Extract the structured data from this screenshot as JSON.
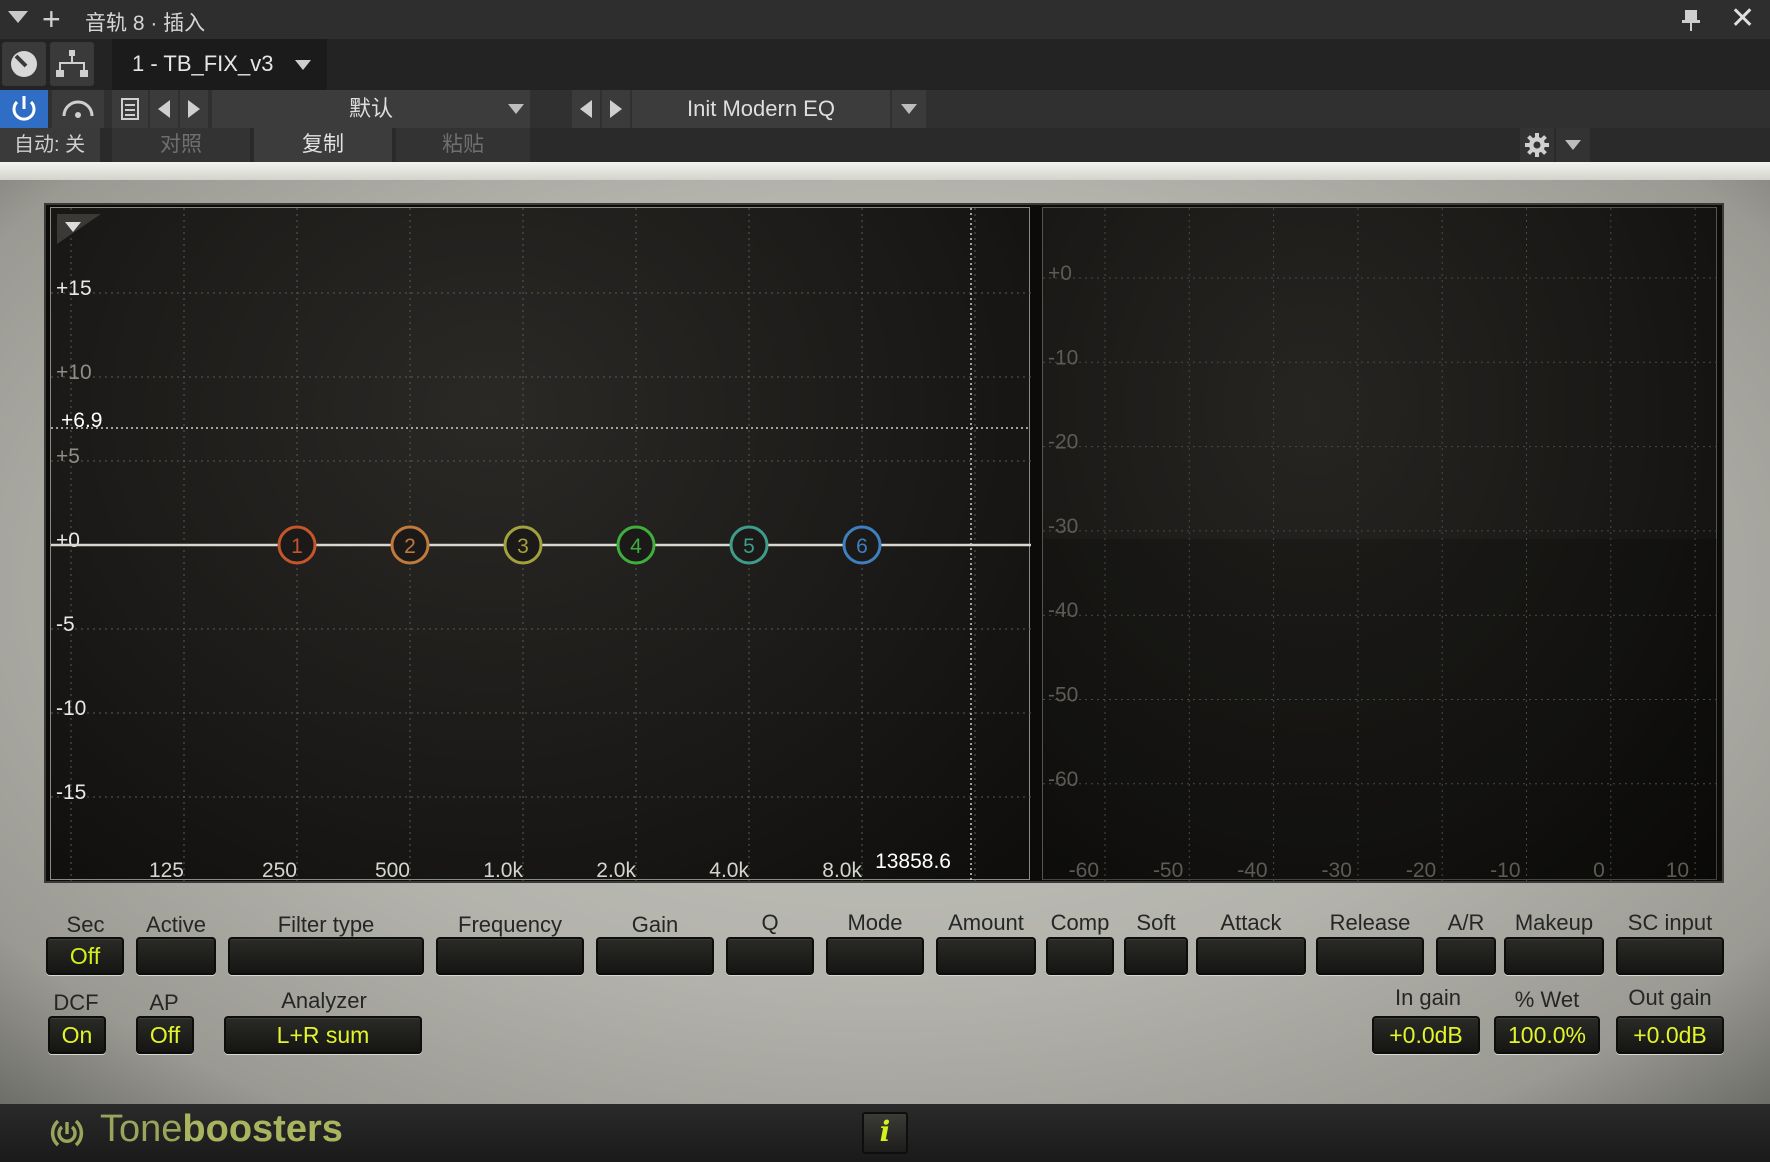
{
  "window": {
    "title": "音轨 8 · 插入",
    "preset_slot": "1 - TB_FIX_v3"
  },
  "toolbar": {
    "preset_bank": "默认",
    "preset_name": "Init Modern EQ",
    "automation": "自动: 关",
    "compare": "对照",
    "copy": "复制",
    "paste": "粘贴"
  },
  "eq": {
    "gain_ticks": [
      "+15",
      "+10",
      "+6.9",
      "+5",
      "+0",
      "-5",
      "-10",
      "-15"
    ],
    "freq_ticks": [
      "125",
      "250",
      "500",
      "1.0k",
      "2.0k",
      "4.0k",
      "8.0k"
    ],
    "cursor_freq": "13858.6",
    "cursor_gain": "+6.9",
    "bands": [
      {
        "label": "1",
        "color": "#c4562a"
      },
      {
        "label": "2",
        "color": "#c07a3a"
      },
      {
        "label": "3",
        "color": "#a3a03e"
      },
      {
        "label": "4",
        "color": "#3fae3c"
      },
      {
        "label": "5",
        "color": "#3f9c8a"
      },
      {
        "label": "6",
        "color": "#3f7fc0"
      }
    ]
  },
  "analyzer": {
    "y_ticks": [
      "+0",
      "-10",
      "-20",
      "-30",
      "-40",
      "-50",
      "-60"
    ],
    "x_ticks": [
      "-60",
      "-50",
      "-40",
      "-30",
      "-20",
      "-10",
      "0",
      "10"
    ]
  },
  "controls": {
    "sec": {
      "label": "Sec",
      "value": "Off"
    },
    "active": {
      "label": "Active",
      "value": ""
    },
    "filter_type": {
      "label": "Filter type",
      "value": ""
    },
    "frequency": {
      "label": "Frequency",
      "value": ""
    },
    "gain": {
      "label": "Gain",
      "value": ""
    },
    "q": {
      "label": "Q",
      "value": ""
    },
    "mode": {
      "label": "Mode",
      "value": ""
    },
    "amount": {
      "label": "Amount",
      "value": ""
    },
    "comp": {
      "label": "Comp",
      "value": ""
    },
    "soft": {
      "label": "Soft",
      "value": ""
    },
    "attack": {
      "label": "Attack",
      "value": ""
    },
    "release": {
      "label": "Release",
      "value": ""
    },
    "ar": {
      "label": "A/R",
      "value": ""
    },
    "makeup": {
      "label": "Makeup",
      "value": ""
    },
    "sc_input": {
      "label": "SC input",
      "value": ""
    },
    "dcf": {
      "label": "DCF",
      "value": "On"
    },
    "ap": {
      "label": "AP",
      "value": "Off"
    },
    "analyzer": {
      "label": "Analyzer",
      "value": "L+R sum"
    },
    "in_gain": {
      "label": "In gain",
      "value": "+0.0dB"
    },
    "wet": {
      "label": "% Wet",
      "value": "100.0%"
    },
    "out_gain": {
      "label": "Out gain",
      "value": "+0.0dB"
    }
  },
  "footer": {
    "brand_prefix": "Tone",
    "brand_suffix": "boosters",
    "info": "i"
  }
}
